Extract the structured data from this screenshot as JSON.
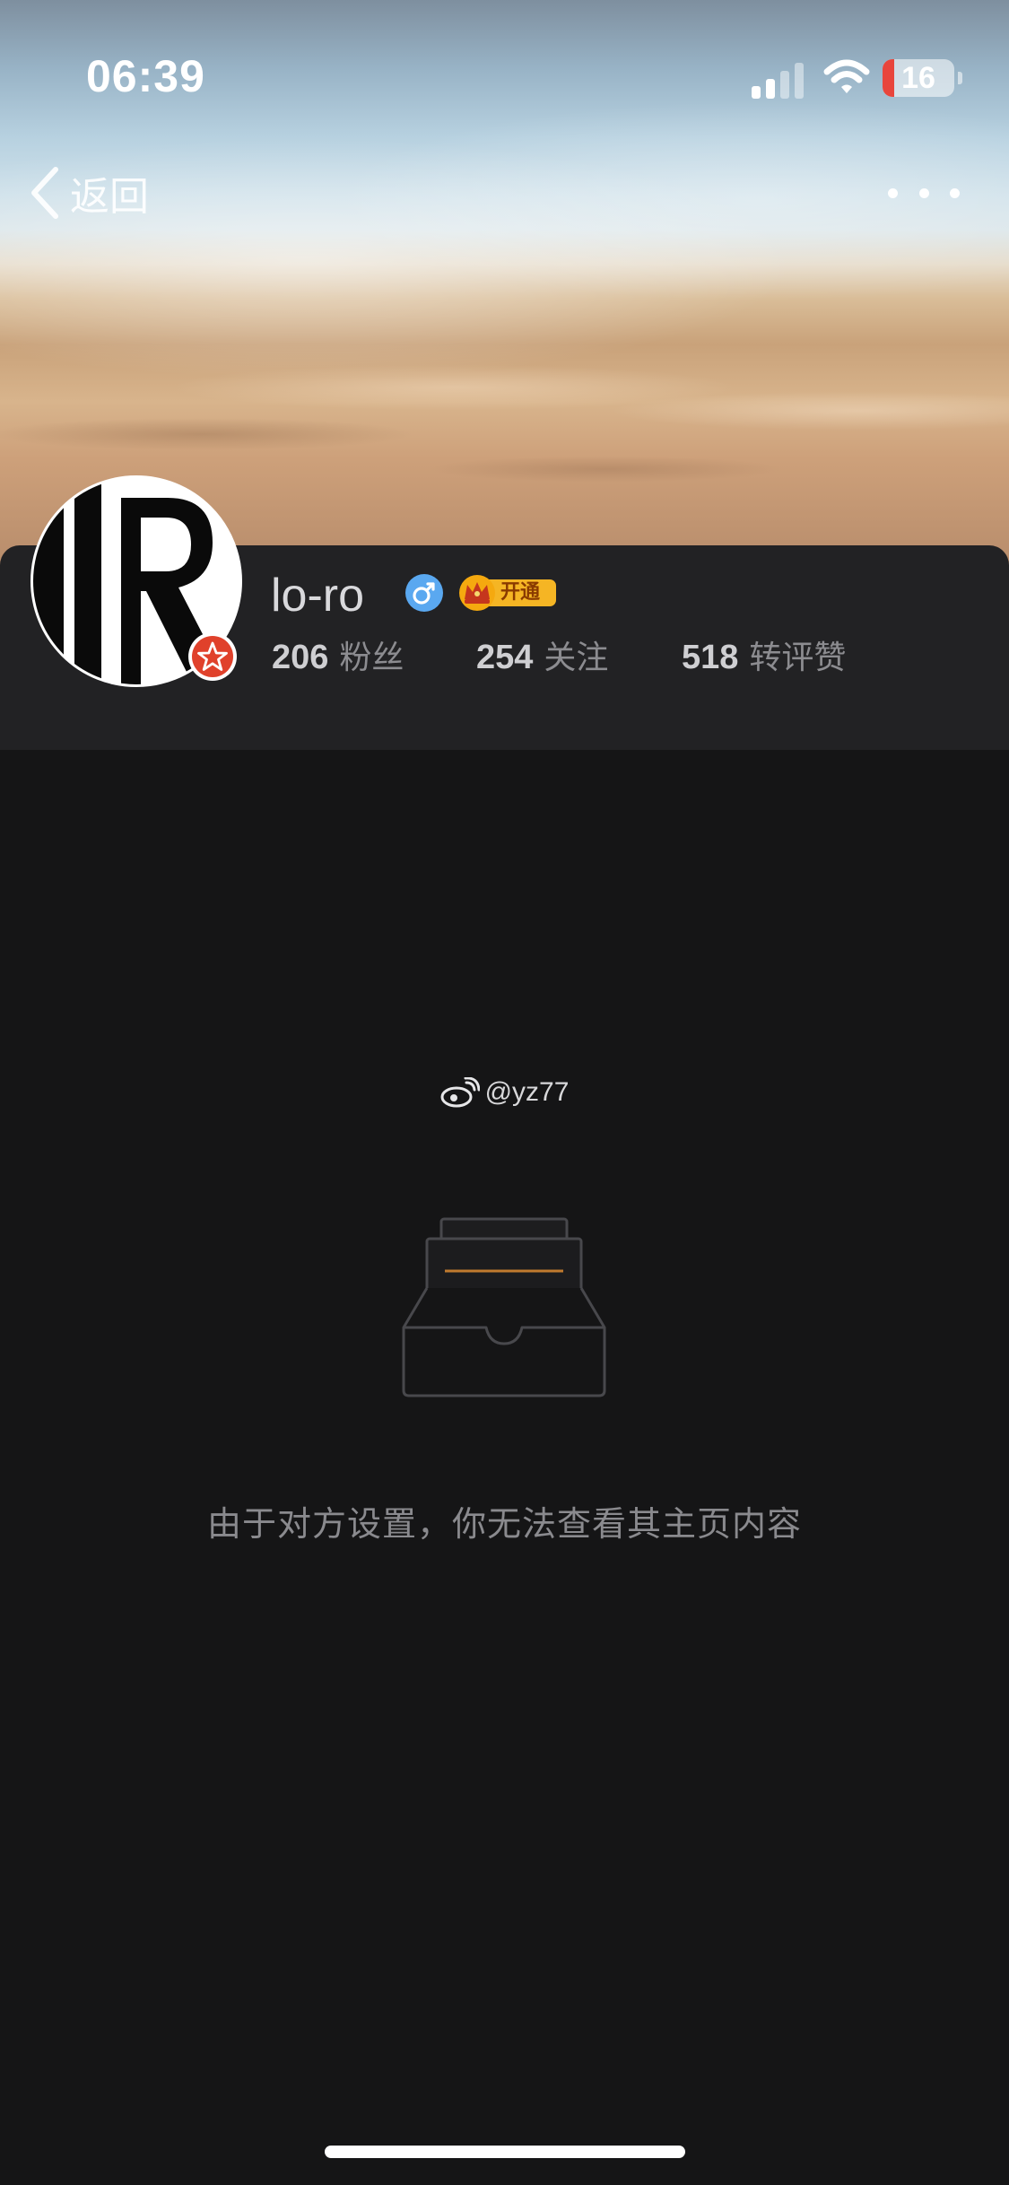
{
  "status_bar": {
    "time": "06:39",
    "battery_level": "16",
    "battery_fraction": 0.16
  },
  "nav": {
    "back_label": "返回"
  },
  "profile": {
    "username": "lo-ro",
    "vip_label": "开通",
    "stats": [
      {
        "value": "206",
        "label": "粉丝"
      },
      {
        "value": "254",
        "label": "关注"
      },
      {
        "value": "518",
        "label": "转评赞"
      }
    ]
  },
  "content": {
    "watermark": "@yz77",
    "empty_message": "由于对方设置，你无法查看其主页内容"
  },
  "colors": {
    "background": "#151516",
    "card": "#222224",
    "battery_low": "#e8453c",
    "gender_male": "#5aa8f0",
    "vip_gold": "#f5b524",
    "illustration_accent": "#c07a2e"
  },
  "icons": {
    "back": "chevron-left-icon",
    "more": "more-dots-icon",
    "gender": "male-icon",
    "vip": "crown-icon",
    "watermark": "weibo-logo-icon",
    "empty_state": "inbox-document-icon"
  }
}
